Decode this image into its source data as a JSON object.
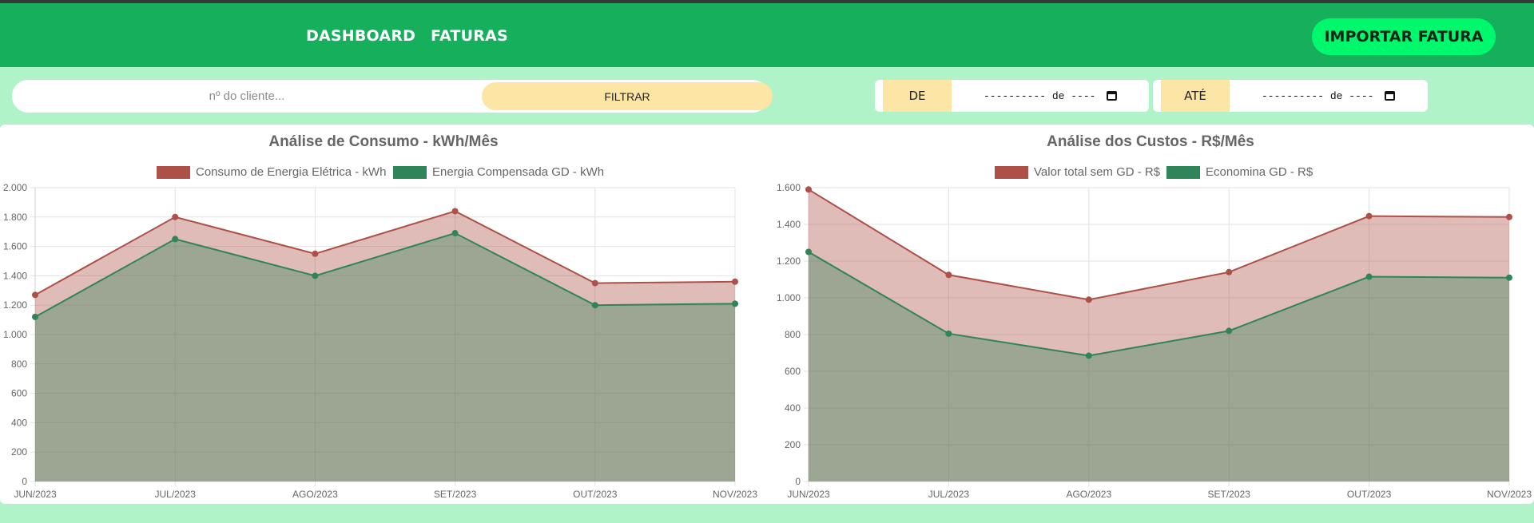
{
  "nav": {
    "links": [
      "DASHBOARD",
      "FATURAS"
    ],
    "import_button": "IMPORTAR FATURA"
  },
  "filter": {
    "client_placeholder": "nº do cliente...",
    "filter_button": "FILTRAR"
  },
  "dates": {
    "from_label": "DE",
    "to_label": "ATÉ",
    "from_value": "---------- de ----",
    "to_value": "---------- de ----"
  },
  "colors": {
    "nav": "#16b05d",
    "background": "#b1f3c8",
    "accent_button": "#00f86c",
    "highlight": "#fde5a5",
    "series_red": "#ad5048",
    "series_green": "#2f8458"
  },
  "chart_data": [
    {
      "type": "area",
      "title": "Análise de Consumo - kWh/Mês",
      "categories": [
        "JUN/2023",
        "JUL/2023",
        "AGO/2023",
        "SET/2023",
        "OUT/2023",
        "NOV/2023"
      ],
      "series": [
        {
          "name": "Consumo de Energia Elétrica - kWh",
          "color": "#ad5048",
          "values": [
            1270,
            1800,
            1550,
            1840,
            1350,
            1360
          ]
        },
        {
          "name": "Energia Compensada GD - kWh",
          "color": "#2f8458",
          "values": [
            1120,
            1650,
            1400,
            1690,
            1200,
            1210
          ]
        }
      ],
      "ylim": [
        0,
        2000
      ],
      "yticks": [
        "0",
        "200",
        "400",
        "600",
        "800",
        "1.000",
        "1.200",
        "1.400",
        "1.600",
        "1.800",
        "2.000"
      ],
      "legend": "top",
      "grid": true
    },
    {
      "type": "area",
      "title": "Análise dos Custos - R$/Mês",
      "categories": [
        "JUN/2023",
        "JUL/2023",
        "AGO/2023",
        "SET/2023",
        "OUT/2023",
        "NOV/2023"
      ],
      "series": [
        {
          "name": "Valor total sem GD - R$",
          "color": "#ad5048",
          "values": [
            1590,
            1125,
            990,
            1140,
            1445,
            1440
          ]
        },
        {
          "name": "Economina GD - R$",
          "color": "#2f8458",
          "values": [
            1250,
            805,
            685,
            820,
            1115,
            1110
          ]
        }
      ],
      "ylim": [
        0,
        1600
      ],
      "yticks": [
        "0",
        "200",
        "400",
        "600",
        "800",
        "1.000",
        "1.200",
        "1.400",
        "1.600"
      ],
      "legend": "top",
      "grid": true
    }
  ]
}
